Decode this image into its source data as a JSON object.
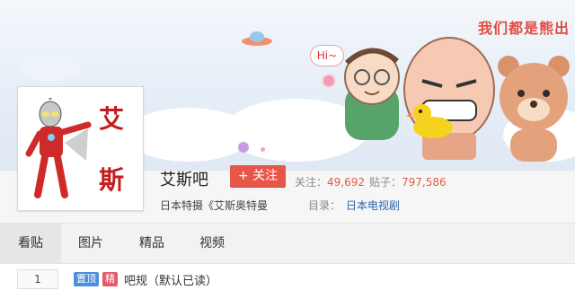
{
  "banner": {
    "deco_text": "我们都是熊出",
    "bubble_text": "Hi~"
  },
  "forum": {
    "name": "艾斯吧",
    "follow_label": "+ 关注",
    "followers_label": "关注：",
    "followers": "49,692",
    "posts_label": "贴子：",
    "posts": "797,586",
    "description": "日本特摄《艾斯奥特曼",
    "category_label": "目录：",
    "category": "日本电视剧",
    "avatar_chars": [
      "艾",
      "斯"
    ]
  },
  "tabs": [
    "看贴",
    "图片",
    "精品",
    "视频"
  ],
  "active_tab": "看贴",
  "thread": {
    "reply_count": "1",
    "badge_top": "置顶",
    "badge_top_color": "#4d8fd8",
    "badge_elite": "精",
    "badge_elite_color": "#e4596b",
    "title": "吧规（默认已读）"
  }
}
